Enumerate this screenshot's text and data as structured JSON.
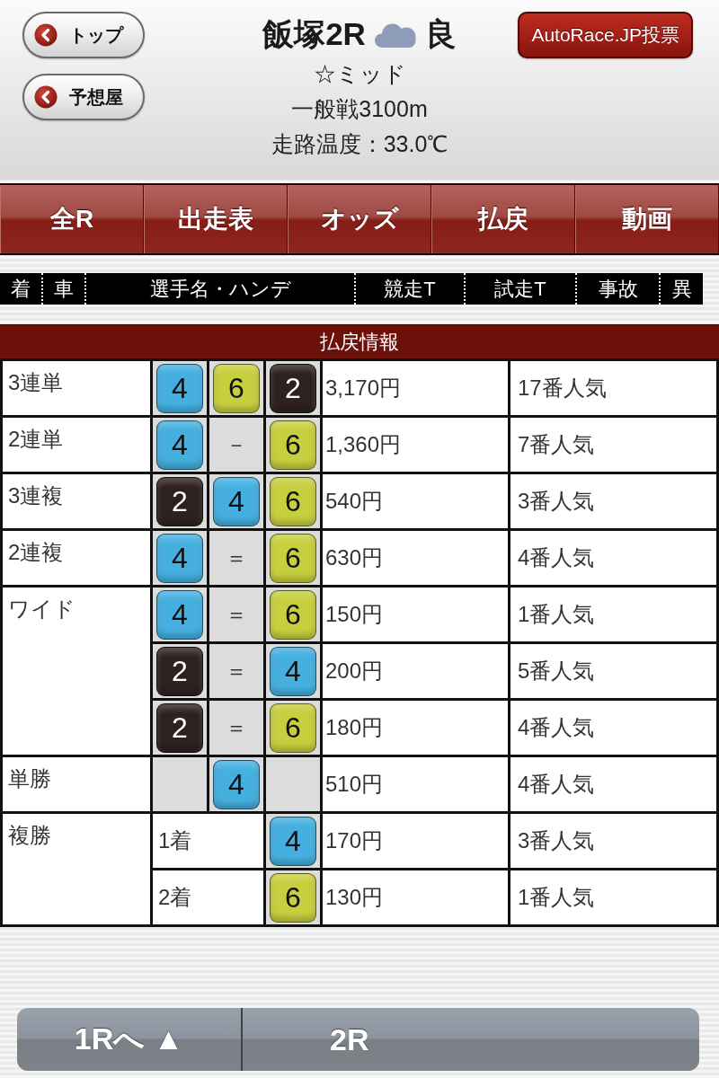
{
  "header": {
    "back_buttons": [
      {
        "label": "トップ"
      },
      {
        "label": "予想屋"
      }
    ],
    "title": "飯塚2R",
    "track_condition": "良",
    "info_lines": [
      "☆ミッド",
      "一般戦3100m",
      "走路温度：33.0℃"
    ],
    "vote_button": "AutoRace.JP投票"
  },
  "tabs": [
    {
      "label": "全R"
    },
    {
      "label": "出走表"
    },
    {
      "label": "オッズ"
    },
    {
      "label": "払戻"
    },
    {
      "label": "動画"
    }
  ],
  "results_header": {
    "columns": [
      "着",
      "車",
      "選手名・ハンデ",
      "競走T",
      "試走T",
      "事故",
      "異"
    ]
  },
  "payout": {
    "title": "払戻情報",
    "rows": [
      {
        "bet_type": "3連単",
        "lines": [
          {
            "cells": [
              {
                "kind": "car",
                "number": "4",
                "color": "#45b0e0"
              },
              {
                "kind": "car",
                "number": "6",
                "color": "#c8cf3e"
              },
              {
                "kind": "car",
                "number": "2",
                "color": "#2e2220"
              }
            ],
            "payout": "3,170円",
            "popularity": "17番人気"
          }
        ]
      },
      {
        "bet_type": "2連単",
        "lines": [
          {
            "cells": [
              {
                "kind": "car",
                "number": "4",
                "color": "#45b0e0"
              },
              {
                "kind": "separator",
                "text": "－"
              },
              {
                "kind": "car",
                "number": "6",
                "color": "#c8cf3e"
              }
            ],
            "payout": "1,360円",
            "popularity": "7番人気"
          }
        ]
      },
      {
        "bet_type": "3連複",
        "lines": [
          {
            "cells": [
              {
                "kind": "car",
                "number": "2",
                "color": "#2e2220"
              },
              {
                "kind": "car",
                "number": "4",
                "color": "#45b0e0"
              },
              {
                "kind": "car",
                "number": "6",
                "color": "#c8cf3e"
              }
            ],
            "payout": "540円",
            "popularity": "3番人気"
          }
        ]
      },
      {
        "bet_type": "2連複",
        "lines": [
          {
            "cells": [
              {
                "kind": "car",
                "number": "4",
                "color": "#45b0e0"
              },
              {
                "kind": "separator",
                "text": "＝"
              },
              {
                "kind": "car",
                "number": "6",
                "color": "#c8cf3e"
              }
            ],
            "payout": "630円",
            "popularity": "4番人気"
          }
        ]
      },
      {
        "bet_type": "ワイド",
        "lines": [
          {
            "cells": [
              {
                "kind": "car",
                "number": "4",
                "color": "#45b0e0"
              },
              {
                "kind": "separator",
                "text": "＝"
              },
              {
                "kind": "car",
                "number": "6",
                "color": "#c8cf3e"
              }
            ],
            "payout": "150円",
            "popularity": "1番人気"
          },
          {
            "cells": [
              {
                "kind": "car",
                "number": "2",
                "color": "#2e2220"
              },
              {
                "kind": "separator",
                "text": "＝"
              },
              {
                "kind": "car",
                "number": "4",
                "color": "#45b0e0"
              }
            ],
            "payout": "200円",
            "popularity": "5番人気"
          },
          {
            "cells": [
              {
                "kind": "car",
                "number": "2",
                "color": "#2e2220"
              },
              {
                "kind": "separator",
                "text": "＝"
              },
              {
                "kind": "car",
                "number": "6",
                "color": "#c8cf3e"
              }
            ],
            "payout": "180円",
            "popularity": "4番人気"
          }
        ]
      },
      {
        "bet_type": "単勝",
        "lines": [
          {
            "cells": [
              {
                "kind": "blank"
              },
              {
                "kind": "car",
                "number": "4",
                "color": "#45b0e0"
              },
              {
                "kind": "blank"
              }
            ],
            "payout": "510円",
            "popularity": "4番人気"
          }
        ]
      },
      {
        "bet_type": "複勝",
        "lines": [
          {
            "cells": [
              {
                "kind": "place",
                "text": "1着"
              },
              {
                "kind": "car",
                "number": "4",
                "color": "#45b0e0"
              }
            ],
            "payout": "170円",
            "popularity": "3番人気"
          },
          {
            "cells": [
              {
                "kind": "place",
                "text": "2着"
              },
              {
                "kind": "car",
                "number": "6",
                "color": "#c8cf3e"
              }
            ],
            "payout": "130円",
            "popularity": "1番人気"
          }
        ]
      }
    ]
  },
  "pager": {
    "previous": "1Rへ ▲",
    "current": "2R"
  }
}
